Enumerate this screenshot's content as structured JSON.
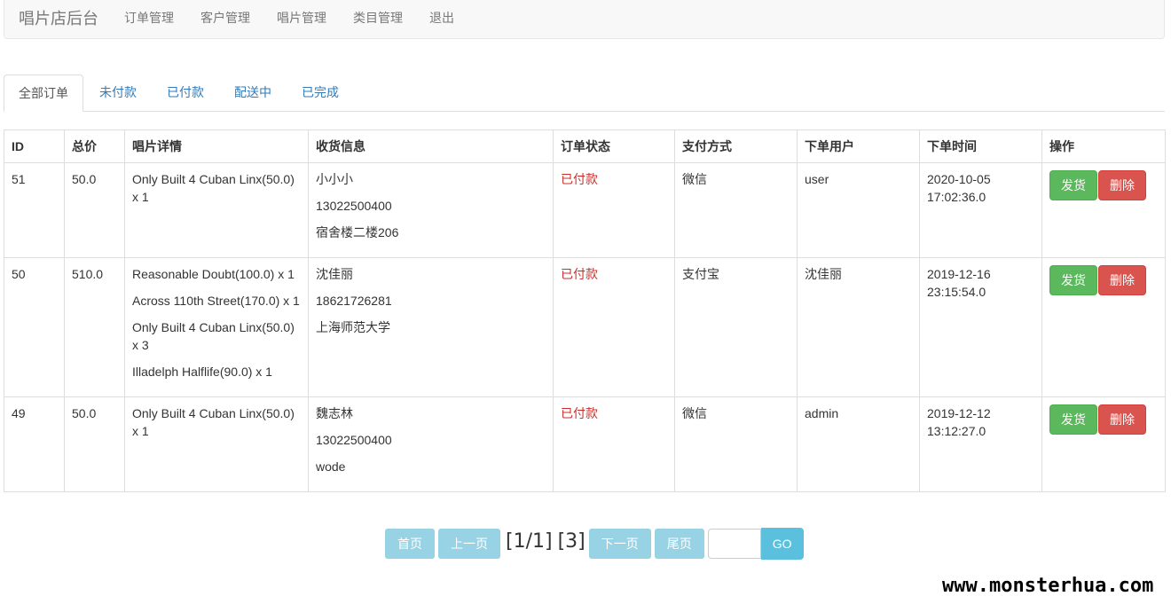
{
  "navbar": {
    "brand": "唱片店后台",
    "links": [
      "订单管理",
      "客户管理",
      "唱片管理",
      "类目管理",
      "退出"
    ]
  },
  "tabs": [
    "全部订单",
    "未付款",
    "已付款",
    "配送中",
    "已完成"
  ],
  "table": {
    "headers": [
      "ID",
      "总价",
      "唱片详情",
      "收货信息",
      "订单状态",
      "支付方式",
      "下单用户",
      "下单时间",
      "操作"
    ],
    "rows": [
      {
        "id": "51",
        "total": "50.0",
        "items": [
          "Only Built 4 Cuban Linx(50.0) x 1"
        ],
        "recipient": [
          "小小小",
          "13022500400",
          "宿舍楼二楼206"
        ],
        "status": "已付款",
        "payment": "微信",
        "user": "user",
        "time": "2020-10-05 17:02:36.0",
        "ship_label": "发货",
        "delete_label": "删除"
      },
      {
        "id": "50",
        "total": "510.0",
        "items": [
          "Reasonable Doubt(100.0) x 1",
          "Across 110th Street(170.0) x 1",
          "Only Built 4 Cuban Linx(50.0) x 3",
          "Illadelph Halflife(90.0) x 1"
        ],
        "recipient": [
          "沈佳丽",
          "18621726281",
          "上海师范大学"
        ],
        "status": "已付款",
        "payment": "支付宝",
        "user": "沈佳丽",
        "time": "2019-12-16 23:15:54.0",
        "ship_label": "发货",
        "delete_label": "删除"
      },
      {
        "id": "49",
        "total": "50.0",
        "items": [
          "Only Built 4 Cuban Linx(50.0) x 1"
        ],
        "recipient": [
          "魏志林",
          "13022500400",
          "wode"
        ],
        "status": "已付款",
        "payment": "微信",
        "user": "admin",
        "time": "2019-12-12 13:12:27.0",
        "ship_label": "发货",
        "delete_label": "删除"
      }
    ]
  },
  "pagination": {
    "first": "首页",
    "prev": "上一页",
    "page_info": "[1/1]",
    "total_info": "[3]",
    "next": "下一页",
    "last": "尾页",
    "go_value": "",
    "go": "GO"
  },
  "watermark": "www.monsterhua.com",
  "colors": {
    "status_paid": "#c9302c",
    "ship_button": "#5cb85c",
    "delete_button": "#d9534f",
    "link": "#337ab7"
  }
}
